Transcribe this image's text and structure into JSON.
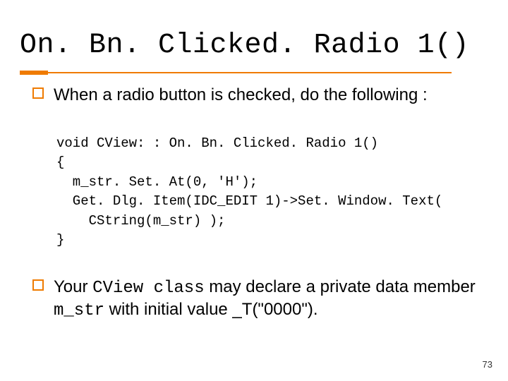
{
  "title": "On. Bn. Clicked. Radio 1()",
  "bullets": [
    {
      "text_before": "When a radio button is checked, do the following :"
    },
    {
      "rich": [
        {
          "t": "Your "
        },
        {
          "t": "CView class",
          "cls": "cview"
        },
        {
          "t": " may declare a private data member "
        },
        {
          "t": "m_str",
          "cls": "mono"
        },
        {
          "t": " with initial value _T(\"0000\")."
        }
      ]
    }
  ],
  "code_lines": [
    "void CView: : On. Bn. Clicked. Radio 1()",
    "{",
    "  m_str. Set. At(0, 'H');",
    "  Get. Dlg. Item(IDC_EDIT 1)->Set. Window. Text(",
    "    CString(m_str) );",
    "}"
  ],
  "page_number": "73"
}
